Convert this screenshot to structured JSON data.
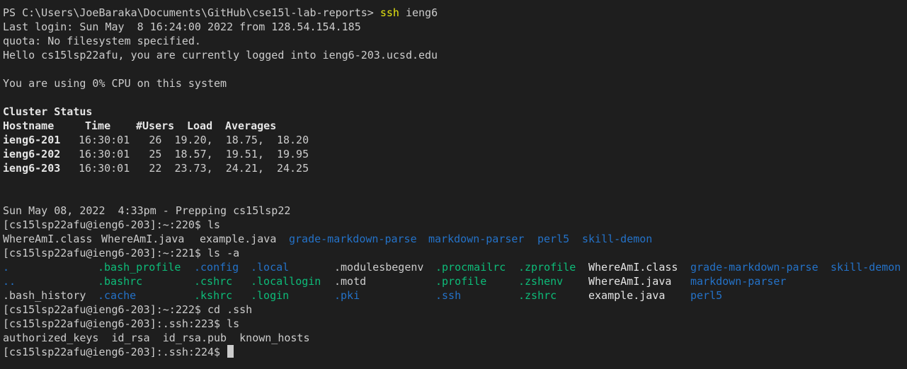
{
  "terminal": {
    "prompt_ps": "PS C:\\Users\\JoeBaraka\\Documents\\GitHub\\cse15l-lab-reports> ",
    "cmd_ssh": "ssh",
    "cmd_ssh_arg": " ieng6",
    "last_login": "Last login: Sun May  8 16:24:00 2022 from 128.54.154.185",
    "quota": "quota: No filesystem specified.",
    "hello": "Hello cs15lsp22afu, you are currently logged into ieng6-203.ucsd.edu",
    "cpu": "You are using 0% CPU on this system",
    "cluster_title": "Cluster Status",
    "cluster_headers": {
      "hostname": "Hostname",
      "time": "Time",
      "users": "#Users",
      "load": "Load",
      "averages": "Averages"
    },
    "cluster_rows": [
      {
        "host": "ieng6-201",
        "rest": "16:30:01   26  19.20,  18.75,  18.20"
      },
      {
        "host": "ieng6-202",
        "rest": "16:30:01   25  18.57,  19.51,  19.95"
      },
      {
        "host": "ieng6-203",
        "rest": "16:30:01   22  23.73,  24.21,  24.25"
      }
    ],
    "prep_line": "Sun May 08, 2022  4:33pm - Prepping cs15lsp22",
    "prompt_220": "[cs15lsp22afu@ieng6-203]:~:220$ ls",
    "ls_output": {
      "f1": "WhereAmI.class",
      "f2": "WhereAmI.java",
      "f3": "example.java",
      "d1": "grade-markdown-parse",
      "d2": "markdown-parser",
      "d3": "perl5",
      "d4": "skill-demon"
    },
    "prompt_221": "[cs15lsp22afu@ieng6-203]:~:221$ ls -a",
    "ls_a": {
      "row1": [
        ".",
        ".bash_profile",
        ".config",
        ".local",
        ".modulesbegenv",
        ".procmailrc",
        ".zprofile",
        "WhereAmI.class",
        "grade-markdown-parse",
        "skill-demon"
      ],
      "row2": [
        "..",
        ".bashrc",
        ".cshrc",
        ".locallogin",
        ".motd",
        ".profile",
        ".zshenv",
        "WhereAmI.java",
        "markdown-parser"
      ],
      "row3": [
        ".bash_history",
        ".cache",
        ".kshrc",
        ".login",
        ".pki",
        ".ssh",
        ".zshrc",
        "example.java",
        "perl5"
      ]
    },
    "prompt_222": "[cs15lsp22afu@ieng6-203]:~:222$ cd .ssh",
    "prompt_223": "[cs15lsp22afu@ieng6-203]:.ssh:223$ ls",
    "ssh_ls": "authorized_keys  id_rsa  id_rsa.pub  known_hosts",
    "prompt_224": "[cs15lsp22afu@ieng6-203]:.ssh:224$ "
  }
}
